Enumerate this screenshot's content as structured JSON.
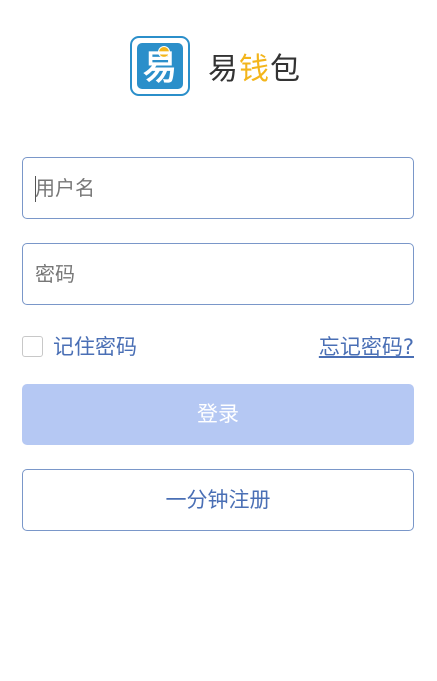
{
  "brand": {
    "logo_glyph": "易",
    "name_part1": "易",
    "name_accent": "钱",
    "name_part2": "包",
    "accent_color": "#f3b51b",
    "logo_color": "#2b8fca"
  },
  "login_form": {
    "username_placeholder": "用户名",
    "password_placeholder": "密码",
    "remember_label": "记住密码",
    "remember_checked": false,
    "forgot_link": "忘记密码?",
    "login_button": "登录",
    "register_button": "一分钟注册"
  },
  "colors": {
    "link_blue": "#4a6fb5",
    "login_button_disabled": "#b5c8f3",
    "field_border": "#7a97c9"
  }
}
